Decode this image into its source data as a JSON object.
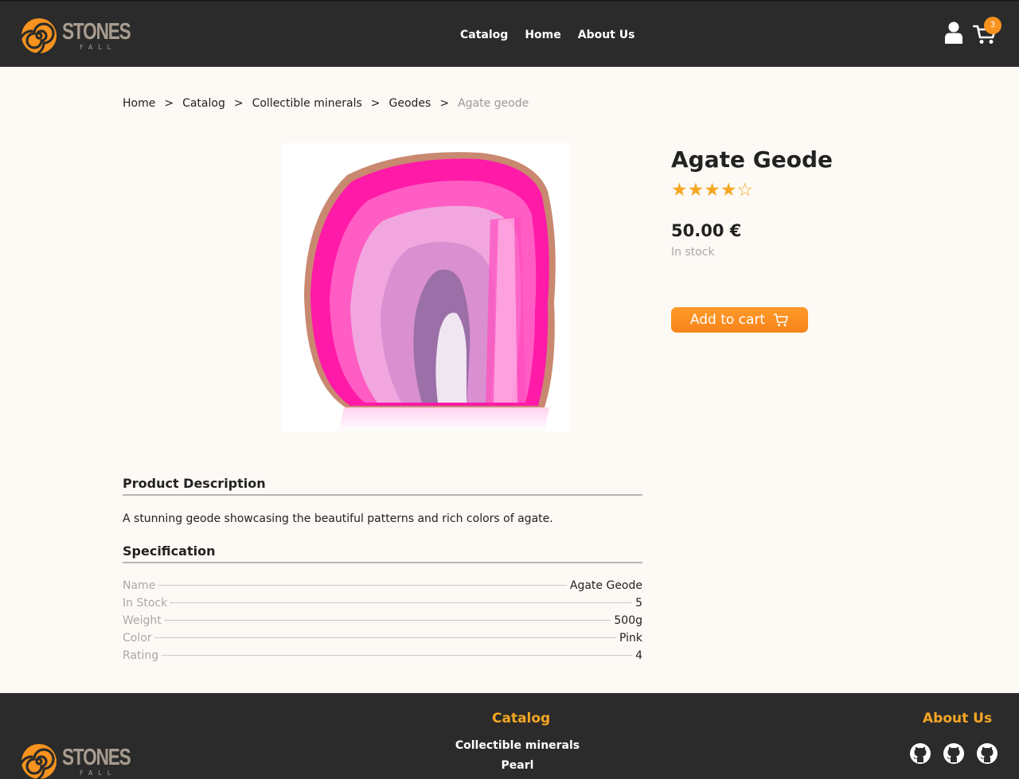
{
  "brand": {
    "logo_text": "STONES",
    "logo_subtext": "FALL",
    "accent_color": "#f7931e",
    "header_color": "#2b2b2b"
  },
  "nav": {
    "items": [
      "Catalog",
      "Home",
      "About Us"
    ]
  },
  "header": {
    "user_icon": "user-icon",
    "cart_icon": "cart-icon",
    "cart_count": "3"
  },
  "breadcrumb": {
    "items": [
      "Home",
      "Catalog",
      "Collectible minerals",
      "Geodes"
    ],
    "separator": ">",
    "current": "Agate geode"
  },
  "product": {
    "title": "Agate Geode",
    "rating": 4,
    "rating_max": 5,
    "stars_text": "★★★★☆",
    "price": "50.00 €",
    "stock_status": "In stock",
    "add_to_cart_label": "Add to cart",
    "image_description_color": "#ff1aa8"
  },
  "description": {
    "title": "Product Description",
    "text": "A stunning geode showcasing the beautiful patterns and rich colors of agate."
  },
  "specification": {
    "title": "Specification",
    "rows": [
      {
        "key": "Name",
        "value": "Agate Geode"
      },
      {
        "key": "In Stock",
        "value": "5"
      },
      {
        "key": "Weight",
        "value": "500g"
      },
      {
        "key": "Color",
        "value": "Pink"
      },
      {
        "key": "Rating",
        "value": "4"
      }
    ]
  },
  "footer": {
    "catalog_title": "Catalog",
    "catalog_links": [
      "Collectible minerals",
      "Pearl"
    ],
    "about_title": "About Us",
    "social_icons": [
      "github-icon",
      "github-icon",
      "github-icon"
    ]
  }
}
